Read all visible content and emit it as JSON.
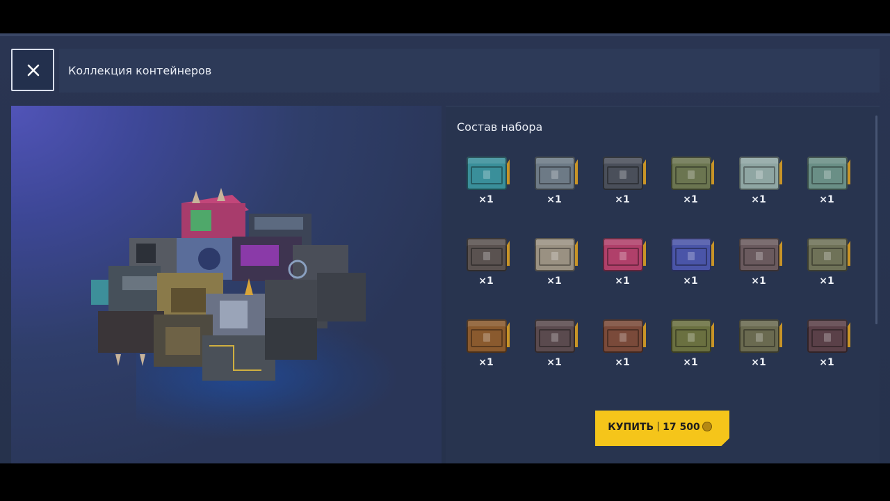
{
  "header": {
    "title": "Коллекция контейнеров"
  },
  "composition": {
    "title": "Состав набора",
    "items": [
      {
        "qty": "×1",
        "icon": "container-icon",
        "color": "#3a8f9a"
      },
      {
        "qty": "×1",
        "icon": "container-icon",
        "color": "#6d7a86"
      },
      {
        "qty": "×1",
        "icon": "container-icon",
        "color": "#4a4f5a"
      },
      {
        "qty": "×1",
        "icon": "container-icon",
        "color": "#6b7550"
      },
      {
        "qty": "×1",
        "icon": "container-icon",
        "color": "#8fa6a3"
      },
      {
        "qty": "×1",
        "icon": "container-icon",
        "color": "#6a8f86"
      },
      {
        "qty": "×1",
        "icon": "container-icon",
        "color": "#5a5250"
      },
      {
        "qty": "×1",
        "icon": "container-icon",
        "color": "#9a9182"
      },
      {
        "qty": "×1",
        "icon": "container-icon",
        "color": "#b0406a"
      },
      {
        "qty": "×1",
        "icon": "container-icon",
        "color": "#4a55a8"
      },
      {
        "qty": "×1",
        "icon": "container-icon",
        "color": "#6a5a5e"
      },
      {
        "qty": "×1",
        "icon": "container-icon",
        "color": "#6f7258"
      },
      {
        "qty": "×1",
        "icon": "container-icon",
        "color": "#8a5a2e"
      },
      {
        "qty": "×1",
        "icon": "container-icon",
        "color": "#5a4a4e"
      },
      {
        "qty": "×1",
        "icon": "container-icon",
        "color": "#7a4a3a"
      },
      {
        "qty": "×1",
        "icon": "container-icon",
        "color": "#6a7040"
      },
      {
        "qty": "×1",
        "icon": "container-icon",
        "color": "#6a6a50"
      },
      {
        "qty": "×1",
        "icon": "container-icon",
        "color": "#5a4048"
      }
    ]
  },
  "buy": {
    "label": "КУПИТЬ",
    "price": "17 500",
    "icon": "coin-icon"
  },
  "colors": {
    "accent": "#f5c51a",
    "badge": "#c89427",
    "panel": "#28344f"
  }
}
